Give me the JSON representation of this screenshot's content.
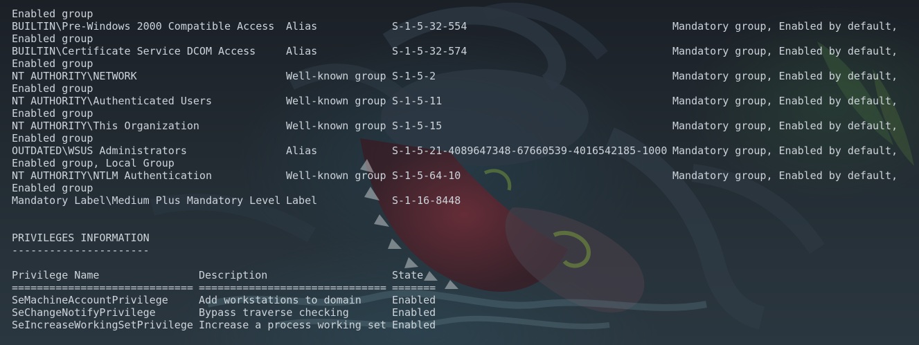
{
  "group_rows": [
    {
      "name": "BUILTIN\\Pre-Windows 2000 Compatible Access",
      "type": "Alias",
      "sid": "S-1-5-32-554",
      "attributes": "Mandatory group, Enabled by default,",
      "attributes_cont": "Enabled group"
    },
    {
      "name": "BUILTIN\\Certificate Service DCOM Access",
      "type": "Alias",
      "sid": "S-1-5-32-574",
      "attributes": "Mandatory group, Enabled by default,",
      "attributes_cont": "Enabled group"
    },
    {
      "name": "NT AUTHORITY\\NETWORK",
      "type": "Well-known group",
      "sid": "S-1-5-2",
      "attributes": "Mandatory group, Enabled by default,",
      "attributes_cont": "Enabled group"
    },
    {
      "name": "NT AUTHORITY\\Authenticated Users",
      "type": "Well-known group",
      "sid": "S-1-5-11",
      "attributes": "Mandatory group, Enabled by default,",
      "attributes_cont": "Enabled group"
    },
    {
      "name": "NT AUTHORITY\\This Organization",
      "type": "Well-known group",
      "sid": "S-1-5-15",
      "attributes": "Mandatory group, Enabled by default,",
      "attributes_cont": "Enabled group"
    },
    {
      "name": "OUTDATED\\WSUS Administrators",
      "type": "Alias",
      "sid": "S-1-5-21-4089647348-67660539-4016542185-1000",
      "attributes": "Mandatory group, Enabled by default,",
      "attributes_cont": "Enabled group, Local Group"
    },
    {
      "name": "NT AUTHORITY\\NTLM Authentication",
      "type": "Well-known group",
      "sid": "S-1-5-64-10",
      "attributes": "Mandatory group, Enabled by default,",
      "attributes_cont": "Enabled group"
    },
    {
      "name": "Mandatory Label\\Medium Plus Mandatory Level",
      "type": "Label",
      "sid": "S-1-16-8448",
      "attributes": "",
      "attributes_cont": ""
    }
  ],
  "top_continuation": "Enabled group",
  "privileges": {
    "title": "PRIVILEGES INFORMATION",
    "title_rule": "----------------------",
    "headers": {
      "name": "Privilege Name",
      "description": "Description",
      "state": "State"
    },
    "header_rules": {
      "name": "=============================",
      "description": "==============================",
      "state": "======="
    },
    "rows": [
      {
        "name": "SeMachineAccountPrivilege",
        "description": "Add workstations to domain",
        "state": "Enabled"
      },
      {
        "name": "SeChangeNotifyPrivilege",
        "description": "Bypass traverse checking",
        "state": "Enabled"
      },
      {
        "name": "SeIncreaseWorkingSetPrivilege",
        "description": "Increase a process working set",
        "state": "Enabled"
      }
    ]
  }
}
